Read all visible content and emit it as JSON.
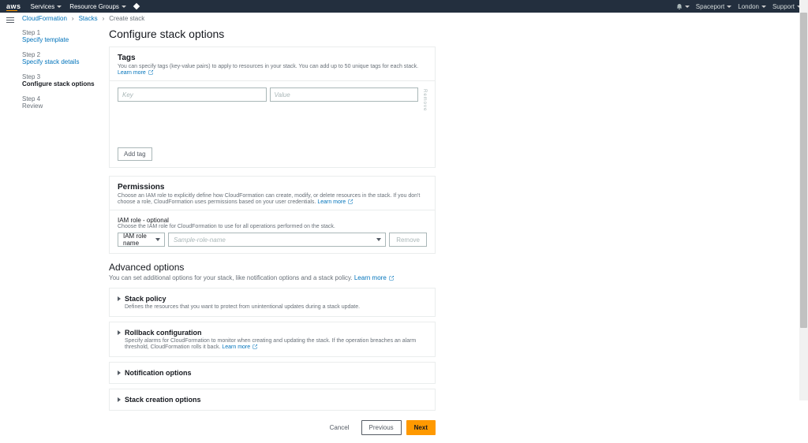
{
  "nav": {
    "logo": "aws",
    "services": "Services",
    "resource_groups": "Resource Groups",
    "account": "Spaceport",
    "region": "London",
    "support": "Support"
  },
  "breadcrumbs": {
    "b1": "CloudFormation",
    "b2": "Stacks",
    "b3": "Create stack"
  },
  "wizard": {
    "s1": "Step 1",
    "s1t": "Specify template",
    "s2": "Step 2",
    "s2t": "Specify stack details",
    "s3": "Step 3",
    "s3t": "Configure stack options",
    "s4": "Step 4",
    "s4t": "Review"
  },
  "page_title": "Configure stack options",
  "tags": {
    "heading": "Tags",
    "desc": "You can specify tags (key-value pairs) to apply to resources in your stack. You can add up to 50 unique tags for each stack.",
    "learn_more": "Learn more",
    "key_ph": "Key",
    "value_ph": "Value",
    "remove_side": "Remove",
    "add_tag": "Add tag"
  },
  "permissions": {
    "heading": "Permissions",
    "desc": "Choose an IAM role to explicitly define how CloudFormation can create, modify, or delete resources in the stack. If you don't choose a role, CloudFormation uses permissions based on your user credentials.",
    "learn_more": "Learn more",
    "iam_label": "IAM role - optional",
    "iam_desc": "Choose the IAM role for CloudFormation to use for all operations performed on the stack.",
    "select_value": "IAM role name",
    "name_ph": "Sample-role-name",
    "remove": "Remove"
  },
  "advanced": {
    "heading": "Advanced options",
    "desc": "You can set additional options for your stack, like notification options and a stack policy.",
    "learn_more": "Learn more",
    "stack_policy": {
      "title": "Stack policy",
      "desc": "Defines the resources that you want to protect from unintentional updates during a stack update."
    },
    "rollback": {
      "title": "Rollback configuration",
      "desc": "Specify alarms for CloudFormation to monitor when creating and updating the stack. If the operation breaches an alarm threshold, CloudFormation rolls it back.",
      "learn_more": "Learn more"
    },
    "notification": {
      "title": "Notification options"
    },
    "creation": {
      "title": "Stack creation options"
    }
  },
  "footer": {
    "cancel": "Cancel",
    "previous": "Previous",
    "next": "Next"
  }
}
